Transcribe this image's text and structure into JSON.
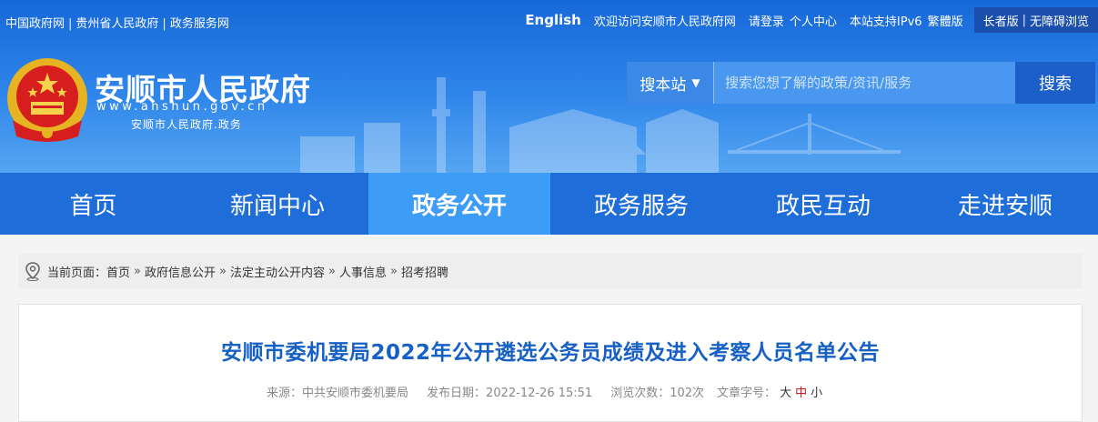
{
  "topbar": {
    "left_links": [
      "中国政府网",
      "贵州省人民政府",
      "政务服务网"
    ],
    "separator": "|",
    "english": "English",
    "welcome": "欢迎访问安顺市人民政府网",
    "login": "请登录",
    "personal": "个人中心",
    "ipv6": "本站支持IPv6",
    "traditional": "繁體版",
    "elderly": "长者版",
    "accessible": "无障碍浏览"
  },
  "site": {
    "title": "安顺市人民政府",
    "url": "www.anshun.gov.cn",
    "slogan": "安顺市人民政府.政务"
  },
  "search": {
    "scope": "搜本站",
    "placeholder": "搜索您想了解的政策/资讯/服务",
    "button": "搜索"
  },
  "nav": {
    "items": [
      "首页",
      "新闻中心",
      "政务公开",
      "政务服务",
      "政民互动",
      "走进安顺"
    ],
    "active_index": 2
  },
  "breadcrumb": {
    "prefix": "当前页面：",
    "items": [
      "首页",
      "政府信息公开",
      "法定主动公开内容",
      "人事信息",
      "招考招聘"
    ],
    "arrow": "»"
  },
  "article": {
    "title": "安顺市委机要局2022年公开遴选公务员成绩及进入考察人员名单公告",
    "source_label": "来源：",
    "source": "中共安顺市委机要局",
    "date_label": "发布日期：",
    "date": "2022-12-26 15:51",
    "views_label": "浏览次数：",
    "views": "102次",
    "fontsize_label": "文章字号：",
    "font_large": "大",
    "font_medium": "中",
    "font_small": "小"
  },
  "colors": {
    "brand_blue": "#1f6dd9",
    "nav_active": "#3d9cf5",
    "title_blue": "#1760c4",
    "accent_red": "#d0141b"
  }
}
